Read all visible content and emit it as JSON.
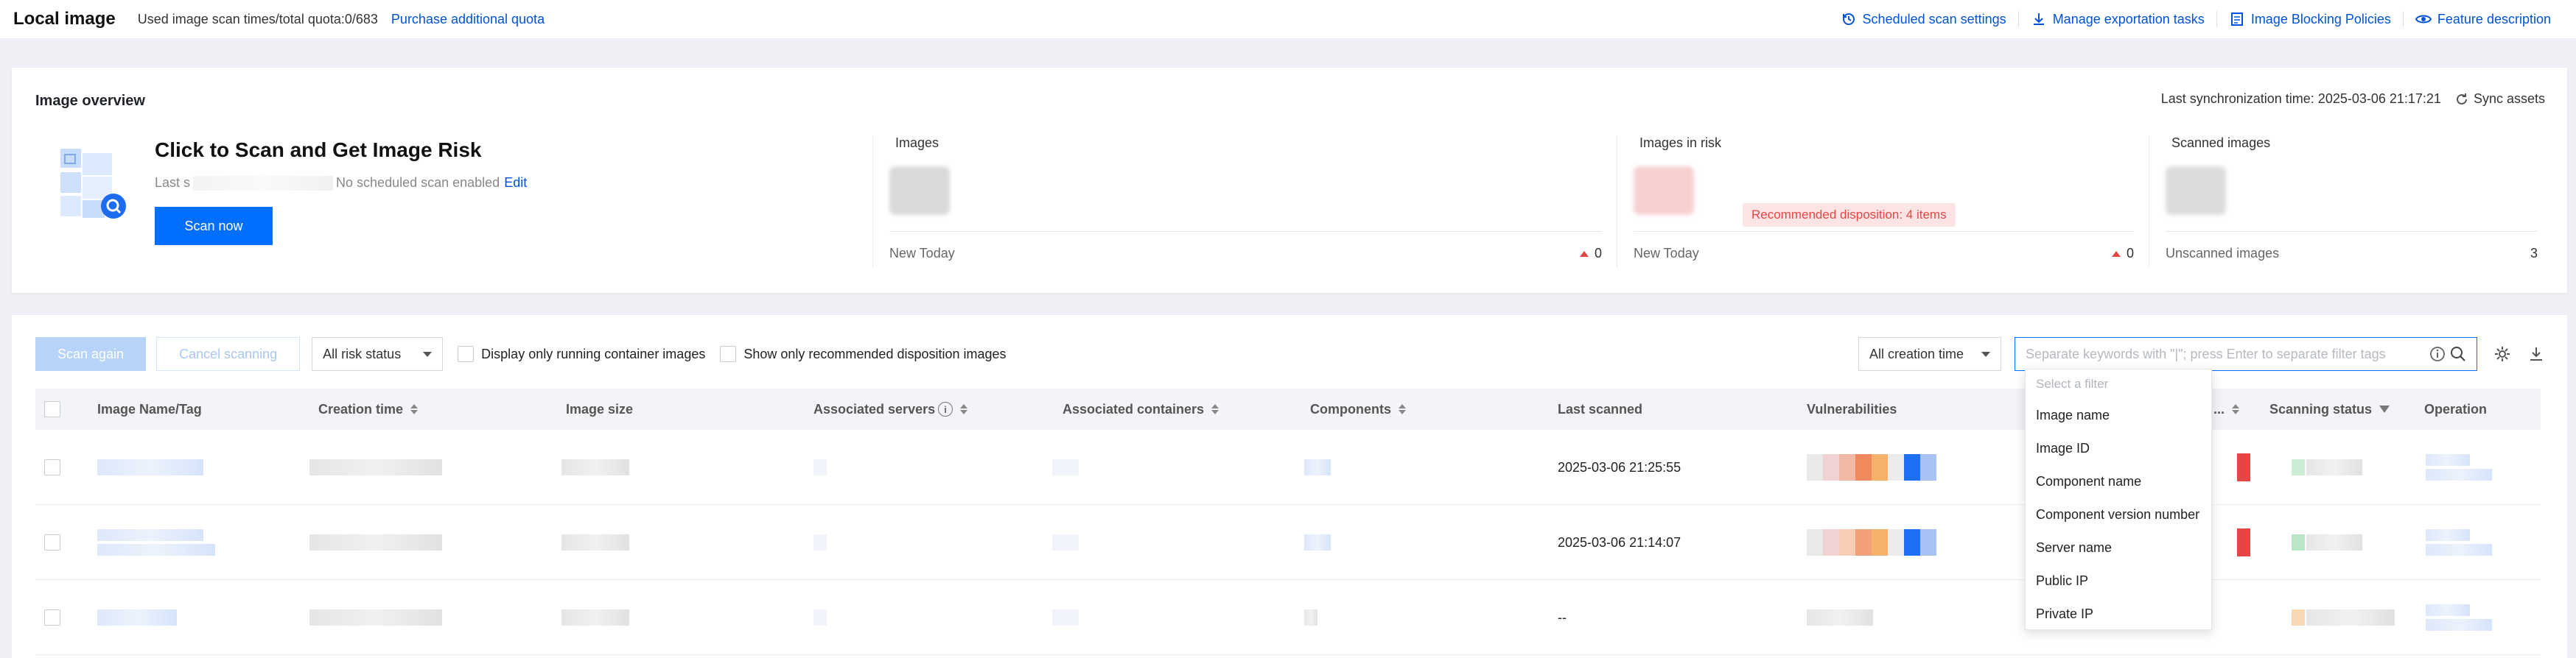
{
  "header": {
    "title": "Local image",
    "quota_text": "Used image scan times/total quota:0/683",
    "quota_link": "Purchase additional quota",
    "actions": [
      {
        "label": "Scheduled scan settings",
        "icon": "clock-refresh-icon"
      },
      {
        "label": "Manage exportation tasks",
        "icon": "download-icon"
      },
      {
        "label": "Image Blocking Policies",
        "icon": "document-icon"
      },
      {
        "label": "Feature description",
        "icon": "eye-icon"
      }
    ]
  },
  "overview": {
    "title": "Image overview",
    "sync_time": "Last synchronization time: 2025-03-06 21:17:21",
    "sync_label": "Sync assets",
    "scan": {
      "heading": "Click to Scan and Get Image Risk",
      "last_prefix": "Last s",
      "no_schedule": "No scheduled scan enabled",
      "edit": "Edit",
      "button": "Scan now"
    },
    "stats": [
      {
        "label": "Images",
        "foot_label": "New Today",
        "foot_value": "0",
        "trend": "up"
      },
      {
        "label": "Images in risk",
        "foot_label": "New Today",
        "foot_value": "0",
        "trend": "up",
        "badge": "Recommended disposition: 4 items"
      },
      {
        "label": "Scanned images",
        "foot_label": "Unscanned images",
        "foot_value": "3"
      }
    ]
  },
  "toolbar": {
    "scan_again": "Scan again",
    "cancel_scanning": "Cancel scanning",
    "risk_status": "All risk status",
    "running_only": "Display only running container images",
    "recommended_only": "Show only recommended disposition images",
    "creation_time": "All creation time",
    "search_placeholder": "Separate keywords with \"|\"; press Enter to separate filter tags"
  },
  "table": {
    "columns": [
      "Image Name/Tag",
      "Creation time",
      "Image size",
      "Associated servers",
      "Associated containers",
      "Components",
      "Last scanned",
      "Vulnerabilities",
      "...",
      "Scanning status",
      "Operation"
    ],
    "rows": [
      {
        "last_scanned": "2025-03-06 21:25:55"
      },
      {
        "last_scanned": "2025-03-06 21:14:07"
      },
      {
        "last_scanned": "--"
      }
    ]
  },
  "filter_dropdown": {
    "hint": "Select a filter",
    "options": [
      "Image name",
      "Image ID",
      "Component name",
      "Component version number",
      "Server name",
      "Public IP",
      "Private IP"
    ]
  },
  "colors": {
    "accent": "#006eff",
    "link": "#0052d9",
    "risk_red": "#e54545",
    "vuln_orange": "#f08a5d",
    "vuln_light_orange": "#f6b26b",
    "vuln_blue": "#1e6ff5"
  }
}
